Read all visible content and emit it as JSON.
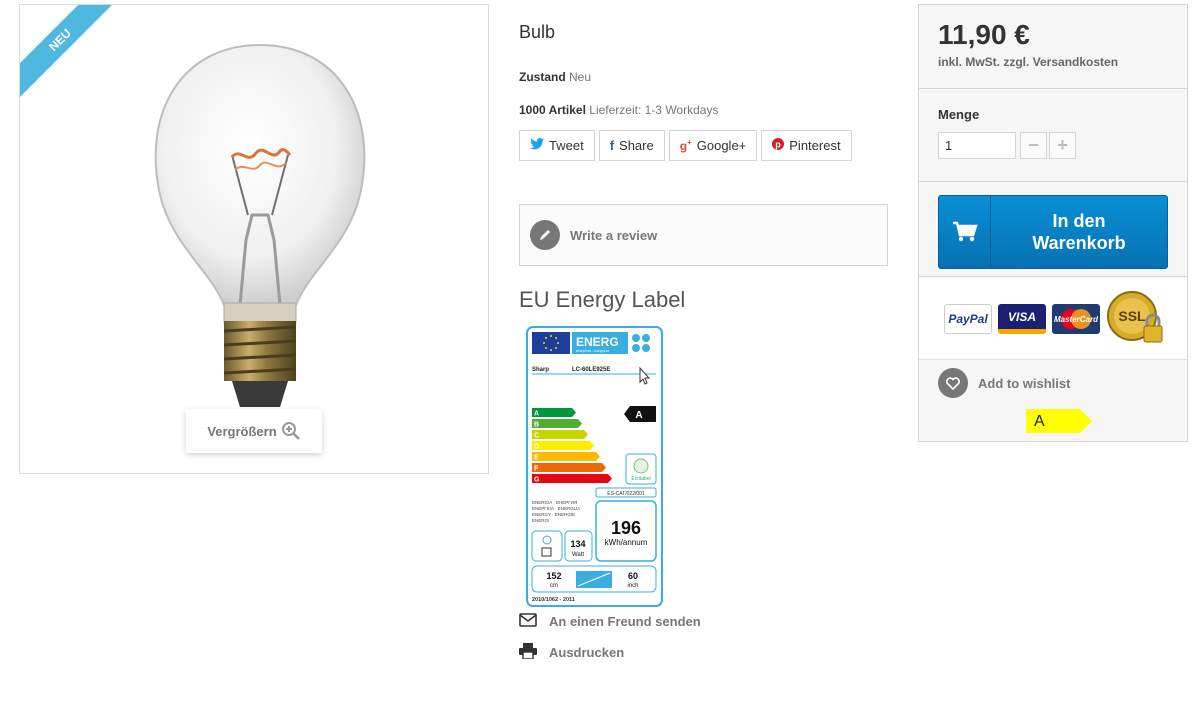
{
  "badge": {
    "new": "NEU"
  },
  "image": {
    "zoom_label": "Vergrößern",
    "alt": "Bulb"
  },
  "product": {
    "title": "Bulb",
    "condition_label": "Zustand",
    "condition_value": "Neu",
    "stock_label": "1000 Artikel",
    "delivery": "Lieferzeit: 1-3 Workdays"
  },
  "social": {
    "tweet": "Tweet",
    "share": "Share",
    "google": "Google+",
    "pinterest": "Pinterest"
  },
  "review": {
    "label": "Write a review"
  },
  "energy": {
    "section_title": "EU Energy Label",
    "header": "ENERG",
    "header_sub": "енергия · ενεργεια",
    "brand": "Sharp",
    "model": "LC-60LE925E",
    "rating": "A",
    "classes": [
      "A",
      "B",
      "C",
      "D",
      "E",
      "F",
      "G"
    ],
    "ecolabel": "Ecolabel",
    "ecolabel_code": "ES-CAT/022/001",
    "languages": [
      "ENERGIA · ЕНЕРГИЯ",
      "ENEPΓEIA · ENERGIJA",
      "ENERGY · ENERGIE",
      "ENERGI"
    ],
    "kwh_value": "196",
    "kwh_unit": "kWh/annum",
    "watt_value": "134",
    "watt_unit": "Watt",
    "cm_value": "152",
    "cm_unit": "cm",
    "inch_value": "60",
    "inch_unit": "inch",
    "regulation": "2010/1062 - 2011"
  },
  "links": {
    "friend": "An einen Freund senden",
    "print": "Ausdrucken"
  },
  "buy": {
    "price": "11,90 €",
    "tax_note": "inkl. MwSt. zzgl. Versandkosten",
    "qty_label": "Menge",
    "qty_value": "1",
    "minus": "−",
    "plus": "+",
    "cart_line1": "In den",
    "cart_line2": "Warenkorb"
  },
  "payments": {
    "paypal": "PayPal",
    "visa": "VISA",
    "mastercard": "MasterCard",
    "ssl": "SSL"
  },
  "wishlist": {
    "label": "Add to wishlist"
  },
  "energy_tag": {
    "rating": "A",
    "color": "#ffff00"
  },
  "colors": {
    "accent": "#0a8fd6",
    "ribbon": "#4fb9e1"
  }
}
